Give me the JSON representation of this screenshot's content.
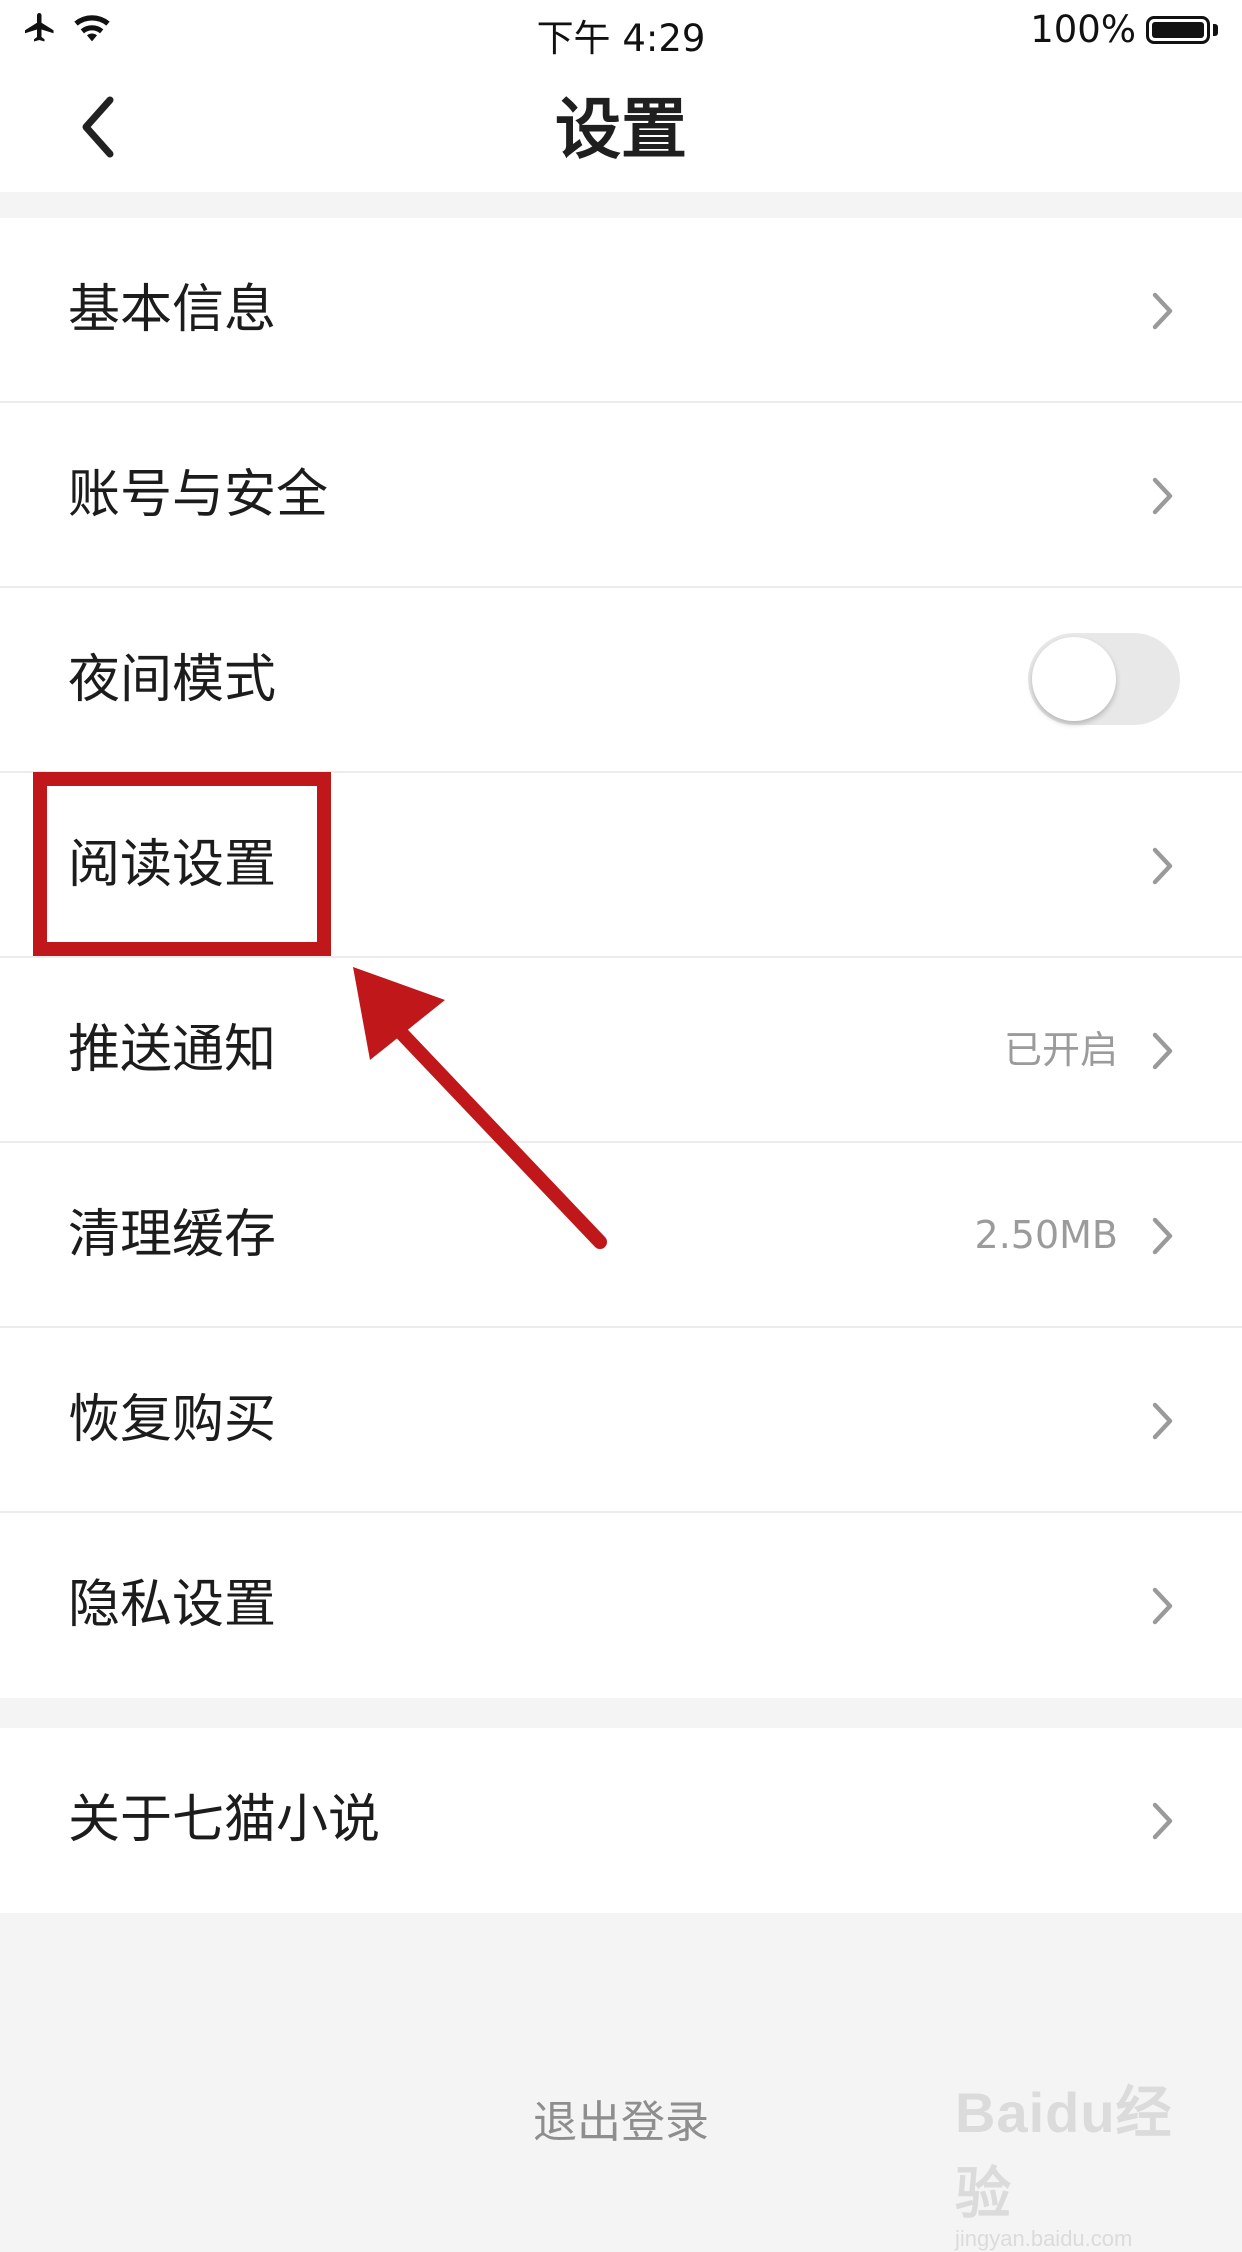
{
  "status_bar": {
    "time": "下午 4:29",
    "battery": "100%",
    "icons": [
      "airplane-icon",
      "wifi-icon",
      "battery-icon"
    ]
  },
  "nav": {
    "title": "设置",
    "back_icon": "chevron-left-icon"
  },
  "settings": {
    "group1": [
      {
        "label": "基本信息",
        "value": "",
        "control": "chevron"
      },
      {
        "label": "账号与安全",
        "value": "",
        "control": "chevron"
      },
      {
        "label": "夜间模式",
        "value": "",
        "control": "toggle",
        "toggle_on": false
      },
      {
        "label": "阅读设置",
        "value": "",
        "control": "chevron"
      },
      {
        "label": "推送通知",
        "value": "已开启",
        "control": "chevron"
      },
      {
        "label": "清理缓存",
        "value": "2.50MB",
        "control": "chevron"
      },
      {
        "label": "恢复购买",
        "value": "",
        "control": "chevron"
      },
      {
        "label": "隐私设置",
        "value": "",
        "control": "chevron"
      }
    ],
    "group2": [
      {
        "label": "关于七猫小说",
        "value": "",
        "control": "chevron"
      }
    ]
  },
  "logout_label": "退出登录",
  "annotation": {
    "highlight_color": "#c0171b",
    "highlighted_item": "阅读设置"
  },
  "watermark": {
    "logo_text": "Baidu经验",
    "sub_text": "jingyan.baidu.com"
  },
  "colors": {
    "background": "#f4f4f4",
    "row_background": "#ffffff",
    "secondary_text": "#9b9b9b",
    "toggle_off": "#e8e8e8"
  }
}
